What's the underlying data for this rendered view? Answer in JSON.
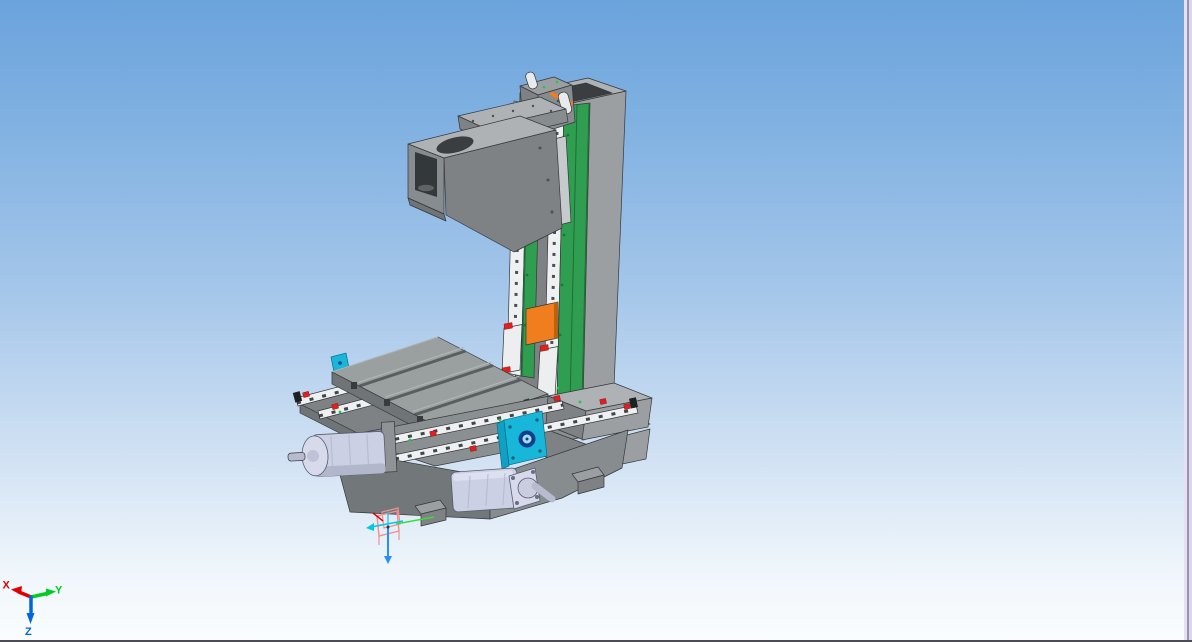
{
  "viewport": {
    "axis_triad": {
      "x_label": "X",
      "y_label": "Y",
      "z_label": "Z"
    }
  },
  "colors": {
    "bg_top": "#6ba3dc",
    "bg_hi": "#7fb0e1",
    "bg_mid": "#a4c6ea",
    "bg_low": "#cfe0f3",
    "bg_faint": "#eef5fb",
    "bg_bottom": "#fbfdfe",
    "edge": "#34383a",
    "gray_mid": "#7e8284",
    "gray_mid2": "#878c8e",
    "gray_mid3": "#8a8f91",
    "gray_light": "#9b9fa1",
    "gray_lighter": "#aeb2b4",
    "gray_dark2": "#6f7476",
    "gray_dark3": "#72777a",
    "plate": "#c6cacc",
    "inner": "#3a3e40",
    "table_top": "#9aa0a0",
    "slot": "#595f61",
    "rail_white": "#eef0f1",
    "tick": "#23272b",
    "rail_green": "#2f9e50",
    "rail_green_dark": "#1e6e38",
    "green_dot": "#27c24a",
    "orange": "#f07d1e",
    "orange_dark": "#c05f10",
    "cyan": "#18b6d9",
    "cyan_dark": "#0a3f8f",
    "motor": "#ccd0e4",
    "motor_face": "#d6daea",
    "red": "#e02020",
    "axis_x": "#e00000",
    "axis_y": "#00cc22",
    "axis_z": "#0066dd",
    "o_pink": "#f29090",
    "o_cyan": "#00c8e8",
    "o_green": "#3ddc3d",
    "o_blue": "#2a8cff",
    "frame_light": "#e6e1f0",
    "frame_dark": "#9a92b4",
    "frame_mid": "#ddd7ea",
    "frame_bottom": "#4c4c55"
  }
}
